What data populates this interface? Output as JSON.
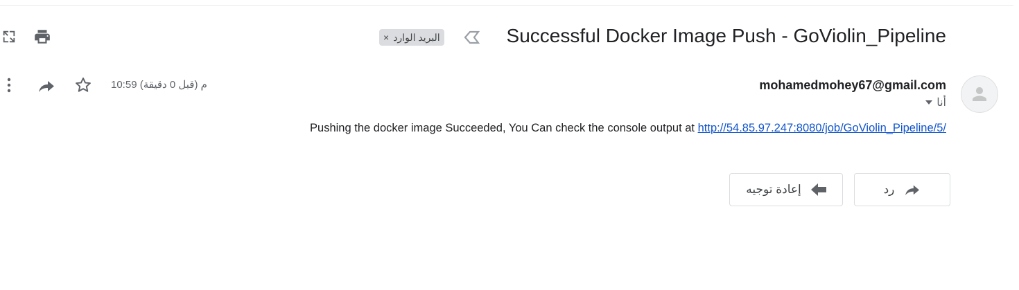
{
  "subject": "Successful Docker Image Push - GoViolin_Pipeline",
  "label": {
    "text": "البريد الوارد",
    "remove": "×"
  },
  "sender": {
    "email": "mohamedmohey67@gmail.com",
    "to": "أنا"
  },
  "timestamp": "10:59 م (قبل 0 دقيقة)",
  "body": {
    "prefix": "Pushing the docker image Succeeded, You Can check the console output at ",
    "link": "http://54.85.97.247:8080/job/GoViolin_Pipeline/5",
    "suffix": "/"
  },
  "actions": {
    "reply": "رد",
    "forward": "إعادة توجيه"
  },
  "icons": {
    "print": "print-icon",
    "new_window": "open-in-new-window-icon",
    "importance": "importance-marker-icon",
    "more": "more-vertical-icon",
    "forward": "forward-icon",
    "star": "star-icon",
    "avatar": "person-icon"
  },
  "colors": {
    "link": "#1155cc",
    "icon": "#5f6368",
    "chip_bg": "#dadce0"
  }
}
